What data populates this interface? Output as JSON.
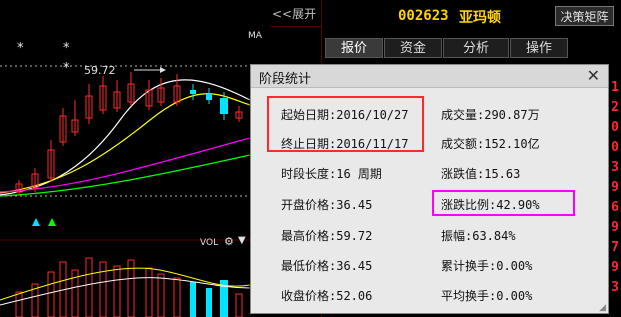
{
  "left_panel": {
    "expand_label": "<<展开",
    "price_annotation": "59.72",
    "ma_label": "MA",
    "vol_label": "VOL",
    "stars": [
      "*",
      "*",
      "*"
    ]
  },
  "header": {
    "stock_code": "002623",
    "stock_name": "亚玛顿",
    "matrix_button": "决策矩阵"
  },
  "tabs": [
    {
      "label": "报价",
      "active": true
    },
    {
      "label": "资金",
      "active": false
    },
    {
      "label": "分析",
      "active": false
    },
    {
      "label": "操作",
      "active": false
    }
  ],
  "right_edge_digits": [
    "1",
    "2",
    "0",
    "0",
    "3",
    "9",
    "6",
    "9",
    "7",
    "9",
    "3"
  ],
  "dialog": {
    "title": "阶段统计",
    "left_stats": [
      {
        "label": "起始日期:",
        "value": "2016/10/27"
      },
      {
        "label": "终止日期:",
        "value": "2016/11/17"
      },
      {
        "label": "时段长度:",
        "value": "16 周期"
      },
      {
        "label": "开盘价格:",
        "value": "36.45"
      },
      {
        "label": "最高价格:",
        "value": "59.72"
      },
      {
        "label": "最低价格:",
        "value": "36.45"
      },
      {
        "label": "收盘价格:",
        "value": "52.06"
      }
    ],
    "right_stats": [
      {
        "label": "成交量:",
        "value": "290.87万"
      },
      {
        "label": "成交额:",
        "value": "152.10亿"
      },
      {
        "label": "涨跌值:",
        "value": "15.63"
      },
      {
        "label": "涨跌比例:",
        "value": "42.90%"
      },
      {
        "label": "振幅:",
        "value": "63.84%"
      },
      {
        "label": "累计换手:",
        "value": "0.00%"
      },
      {
        "label": "平均换手:",
        "value": "0.00%"
      }
    ]
  },
  "colors": {
    "up": "#ff2a2a",
    "down": "#00e5ff",
    "ma_white": "#ffffff",
    "ma_yellow": "#ffff00",
    "ma_magenta": "#ff00ff",
    "ma_green": "#00ff00",
    "highlight_red": "#ff2a2a",
    "highlight_magenta": "#ff00ff"
  }
}
